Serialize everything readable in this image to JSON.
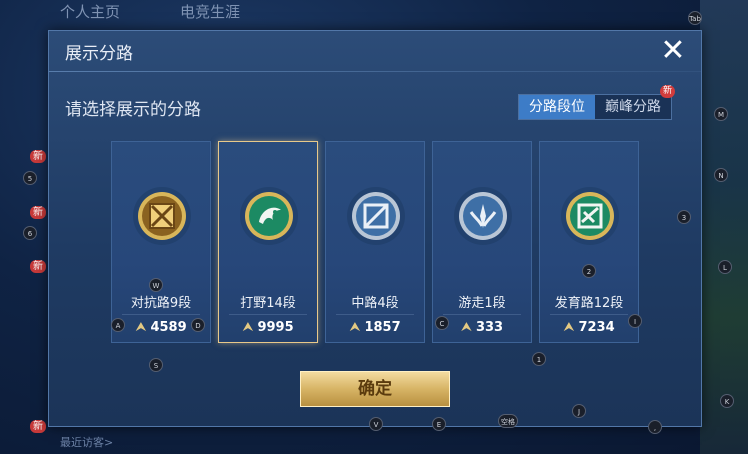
{
  "background": {
    "tabs": [
      "个人主页",
      "电竞生涯"
    ],
    "left_new_badges": [
      "新",
      "新",
      "新",
      "新"
    ],
    "visitor_text": "最近访客>"
  },
  "modal": {
    "title": "展示分路",
    "close_icon": "close-x-icon",
    "prompt": "请选择展示的分路",
    "segment": {
      "options": [
        "分路段位",
        "巅峰分路"
      ],
      "selected": "分路段位",
      "new_badge": "新"
    },
    "cards": [
      {
        "name": "对抗路9段",
        "score": "4589",
        "emblem": "clash-lane-emblem",
        "selected": false
      },
      {
        "name": "打野14段",
        "score": "9995",
        "emblem": "jungle-dragon-emblem",
        "selected": true
      },
      {
        "name": "中路4段",
        "score": "1857",
        "emblem": "mid-lane-emblem",
        "selected": false
      },
      {
        "name": "游走1段",
        "score": "333",
        "emblem": "roam-emblem",
        "selected": false
      },
      {
        "name": "发育路12段",
        "score": "7234",
        "emblem": "farm-lane-emblem",
        "selected": false
      }
    ],
    "confirm_label": "确定"
  },
  "key_hints": [
    "Tab",
    "M",
    "N",
    "3",
    "L",
    "K",
    "W",
    "A",
    "D",
    "S",
    "C",
    "I",
    "1",
    "2",
    "J",
    "V",
    "E",
    "空格",
    "5",
    "6",
    ","
  ]
}
